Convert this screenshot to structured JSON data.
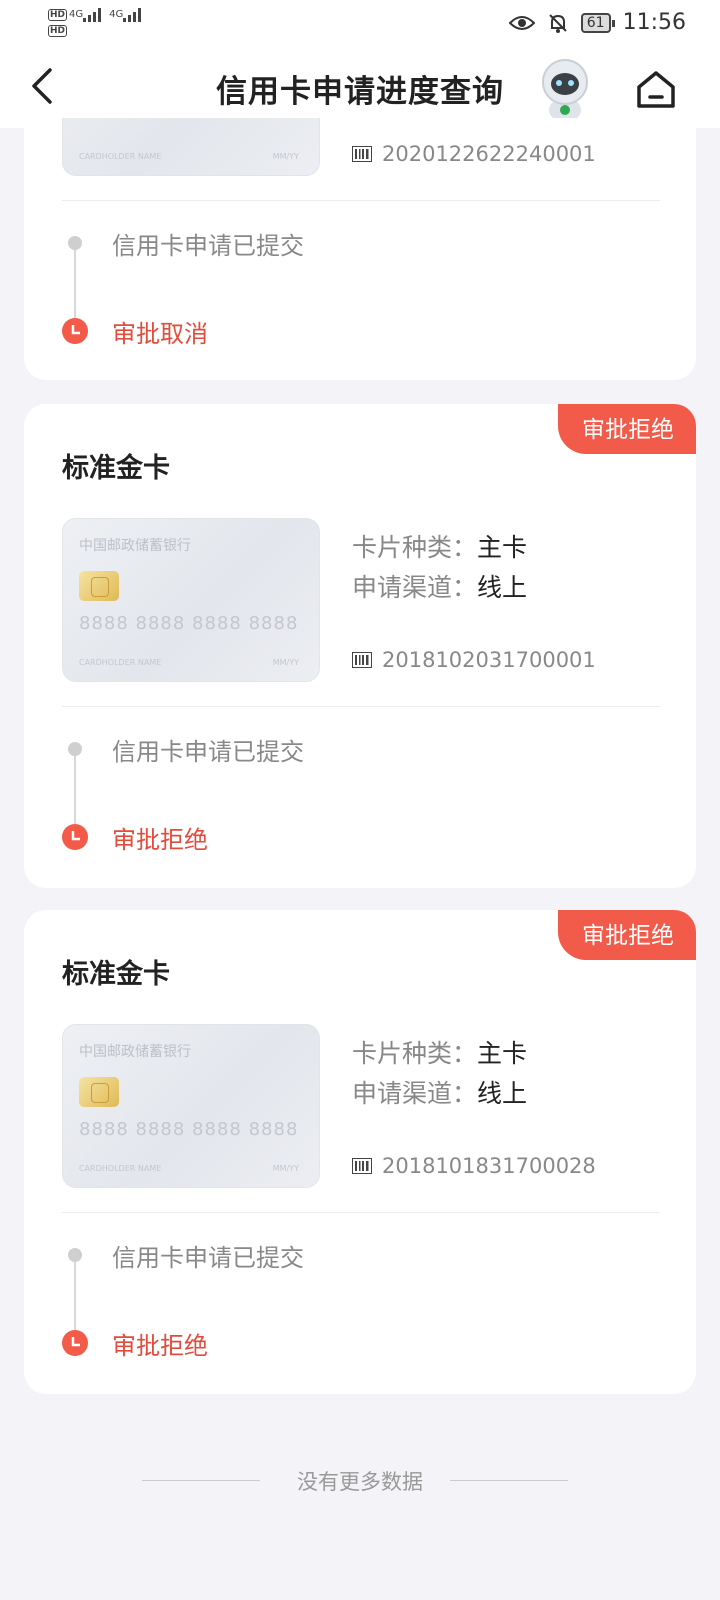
{
  "status_bar": {
    "network_left_1": "HD",
    "network_left_2": "HD",
    "signal_1": "4G",
    "signal_2": "4G",
    "battery": "61",
    "time": "11:56"
  },
  "header": {
    "title": "信用卡申请进度查询"
  },
  "card_image": {
    "bank_name": "中国邮政储蓄银行",
    "number": "8888 8888 8888 8888",
    "holder": "CARDHOLDER NAME",
    "expiry": "MM/YY"
  },
  "applications": [
    {
      "serial": "2020122622240001",
      "steps": [
        {
          "label": "信用卡申请已提交"
        },
        {
          "label": "审批取消"
        }
      ]
    },
    {
      "status_badge": "审批拒绝",
      "card_name": "标准金卡",
      "card_type_label": "卡片种类：",
      "card_type_value": "主卡",
      "channel_label": "申请渠道：",
      "channel_value": "线上",
      "serial": "2018102031700001",
      "steps": [
        {
          "label": "信用卡申请已提交"
        },
        {
          "label": "审批拒绝"
        }
      ]
    },
    {
      "status_badge": "审批拒绝",
      "card_name": "标准金卡",
      "card_type_label": "卡片种类：",
      "card_type_value": "主卡",
      "channel_label": "申请渠道：",
      "channel_value": "线上",
      "serial": "2018101831700028",
      "steps": [
        {
          "label": "信用卡申请已提交"
        },
        {
          "label": "审批拒绝"
        }
      ]
    }
  ],
  "footer": {
    "no_more": "没有更多数据"
  },
  "colors": {
    "accent_red": "#f25a4a",
    "background": "#f4f4f8"
  }
}
